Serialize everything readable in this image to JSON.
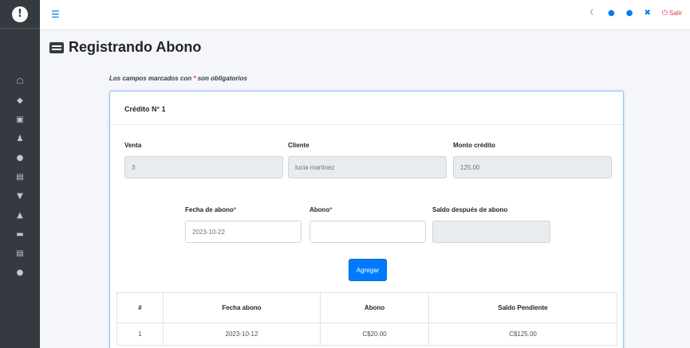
{
  "sidebar": {
    "icons": [
      "home-icon",
      "tag-icon",
      "boxes-icon",
      "user-icon",
      "users-icon",
      "receipt-icon",
      "cart-icon",
      "lock-icon",
      "list-icon",
      "receipt-icon",
      "users-icon"
    ]
  },
  "topbar": {
    "logout_label": "Salir"
  },
  "page": {
    "title": "Registrando Abono",
    "required_note_prefix": "Los campos marcados con ",
    "required_note_star": "*",
    "required_note_suffix": " son obligatorios"
  },
  "card": {
    "header": "Crédito N° 1",
    "venta_label": "Venta",
    "venta_value": "3",
    "cliente_label": "Cliente",
    "cliente_value": "lucia martinez",
    "monto_label": "Monto crédito",
    "monto_value": "125.00",
    "fecha_label": "Fecha de abono",
    "fecha_value": "2023-10-22",
    "abono_label": "Abono",
    "abono_value": "",
    "saldo_label": "Saldo después de abono",
    "saldo_value": "",
    "star": "*",
    "add_button": "Agregar"
  },
  "table": {
    "headers": [
      "#",
      "Fecha abono",
      "Abono",
      "Saldo Pendiente"
    ],
    "rows": [
      [
        "1",
        "2023-10-12",
        "C$20.00",
        "C$125.00"
      ]
    ]
  },
  "colors": {
    "accent": "#007bff",
    "danger": "#dc3545",
    "sidebar": "#343a40"
  }
}
